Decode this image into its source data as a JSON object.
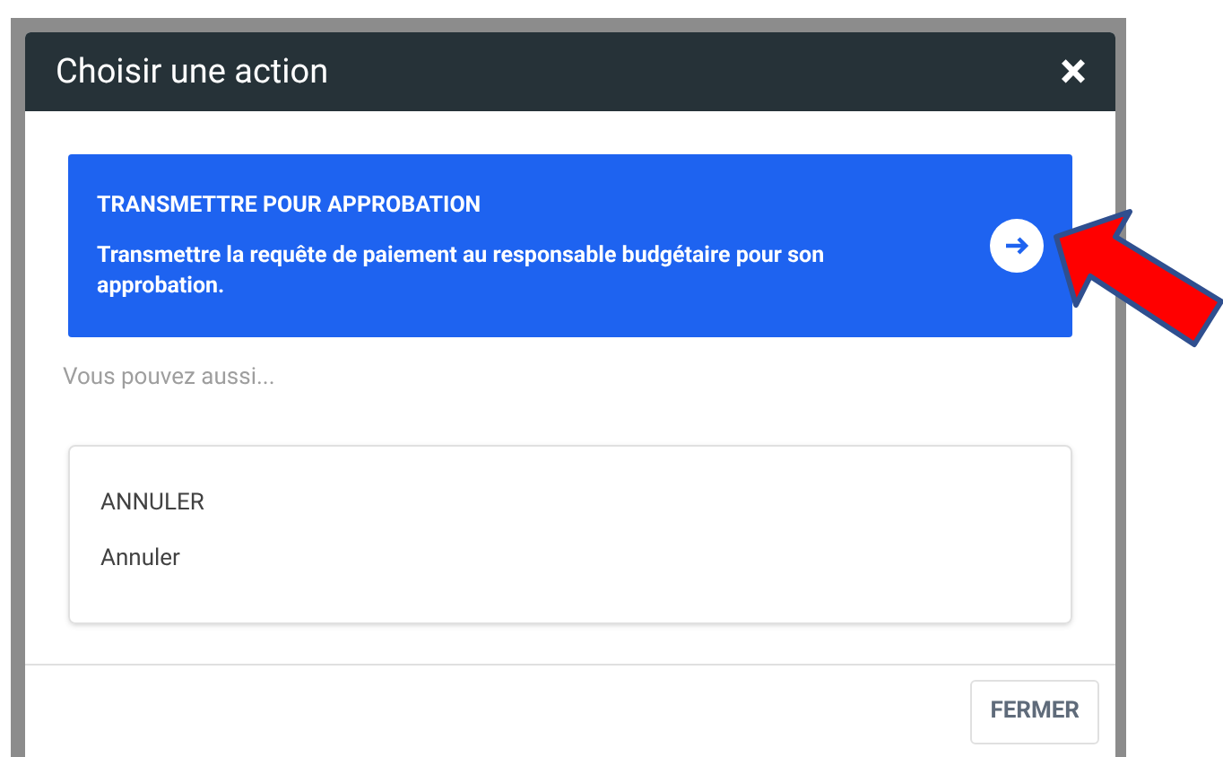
{
  "dialog": {
    "title": "Choisir une action",
    "close": "×"
  },
  "primary_action": {
    "title": "TRANSMETTRE POUR APPROBATION",
    "description": "Transmettre la requête de paiement au responsable budgétaire pour son approbation."
  },
  "alternatives_label": "Vous pouvez aussi...",
  "alternatives": [
    {
      "title": "ANNULER",
      "description": "Annuler"
    }
  ],
  "footer_buttons": [
    "FERMER"
  ]
}
